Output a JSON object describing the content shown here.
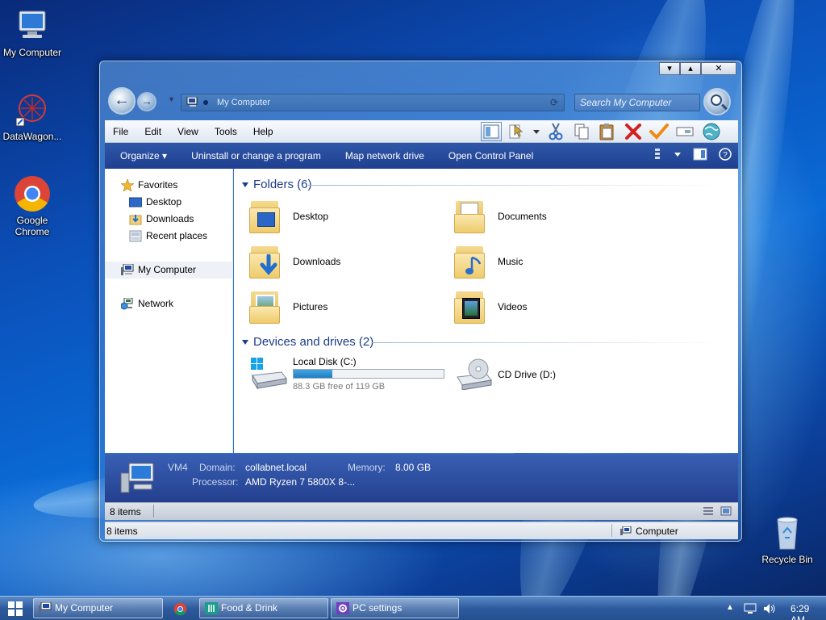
{
  "desktop": {
    "icons": [
      {
        "label": "My Computer"
      },
      {
        "label": "DataWagon..."
      },
      {
        "label": "Google Chrome"
      },
      {
        "label": "Recycle Bin"
      }
    ]
  },
  "window": {
    "address": "My Computer",
    "search_placeholder": "Search My Computer",
    "menu": [
      "File",
      "Edit",
      "View",
      "Tools",
      "Help"
    ],
    "commands": [
      "Organize ▾",
      "Uninstall or change a program",
      "Map network drive",
      "Open Control Panel"
    ],
    "nav": {
      "favorites": "Favorites",
      "desktop": "Desktop",
      "downloads": "Downloads",
      "recent": "Recent places",
      "computer": "My Computer",
      "network": "Network"
    },
    "groups": {
      "folders": "Folders (6)",
      "devices": "Devices and drives (2)"
    },
    "folders": [
      "Desktop",
      "Documents",
      "Downloads",
      "Music",
      "Pictures",
      "Videos"
    ],
    "drives": [
      {
        "name": "Local Disk (C:)",
        "free": "88.3 GB free of 119 GB",
        "used_fraction": 0.258
      },
      {
        "name": "CD Drive (D:)"
      }
    ],
    "details": {
      "name": "VM4",
      "domain_label": "Domain:",
      "domain": "collabnet.local",
      "memory_label": "Memory:",
      "memory": "8.00 GB",
      "processor_label": "Processor:",
      "processor": "AMD Ryzen 7 5800X 8-..."
    },
    "status_top": "8 items",
    "status_bottom_left": "8 items",
    "status_bottom_right": "Computer"
  },
  "taskbar": {
    "tasks": [
      {
        "label": "My Computer"
      },
      {
        "label": "Food & Drink"
      },
      {
        "label": "PC settings"
      }
    ],
    "clock": "6:29 AM"
  },
  "colors": {
    "accent": "#1f3f8f",
    "group_header": "#1e3c8a",
    "drive_fill": "#1f7fc4"
  }
}
